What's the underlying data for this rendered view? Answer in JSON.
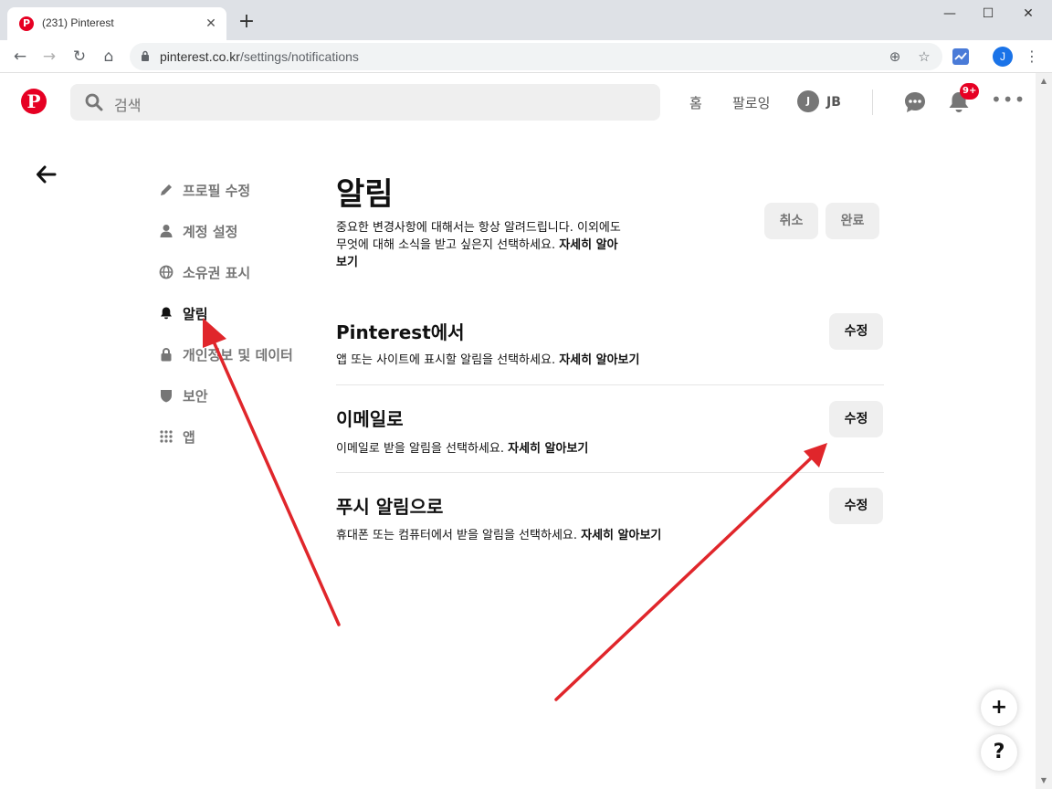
{
  "browser": {
    "tab_title": "(231) Pinterest",
    "tab_close": "✕",
    "new_tab": "+",
    "window_controls": {
      "minimize": "—",
      "maximize": "☐",
      "close": "✕"
    },
    "url_host": "pinterest.co.kr",
    "url_path": "/settings/notifications",
    "profile_initial": "J"
  },
  "header": {
    "logo_letter": "P",
    "search_placeholder": "검색",
    "nav": {
      "home": "홈",
      "following": "팔로잉"
    },
    "user": {
      "initial": "J",
      "name": "JB"
    },
    "notification_badge": "9+",
    "more": "•••"
  },
  "sidebar": {
    "items": [
      {
        "label": "프로필 수정",
        "icon": "pencil-icon"
      },
      {
        "label": "계정 설정",
        "icon": "person-icon"
      },
      {
        "label": "소유권 표시",
        "icon": "globe-icon"
      },
      {
        "label": "알림",
        "icon": "bell-icon",
        "active": true
      },
      {
        "label": "개인정보 및 데이터",
        "icon": "lock-icon"
      },
      {
        "label": "보안",
        "icon": "shield-icon"
      },
      {
        "label": "앱",
        "icon": "grid-icon"
      }
    ]
  },
  "main": {
    "title": "알림",
    "desc_line1": "중요한 변경사항에 대해서는 항상 알려드립니다. 이외에도",
    "desc_line2": "무엇에 대해 소식을 받고 싶은지 선택하세요.",
    "desc_link_part1": "자세히 알아",
    "desc_link_part2": "보기",
    "cancel_label": "취소",
    "done_label": "완료",
    "sections": [
      {
        "title": "Pinterest에서",
        "desc": "앱 또는 사이트에 표시할 알림을 선택하세요.",
        "link": "자세히 알아보기",
        "button": "수정"
      },
      {
        "title": "이메일로",
        "desc": "이메일로 받을 알림을 선택하세요.",
        "link": "자세히 알아보기",
        "button": "수정"
      },
      {
        "title": "푸시 알림으로",
        "desc": "휴대폰 또는 컴퓨터에서 받을 알림을 선택하세요.",
        "link": "자세히 알아보기",
        "button": "수정"
      }
    ]
  },
  "fab": {
    "add": "+",
    "help": "?"
  },
  "colors": {
    "brand": "#e60023",
    "annotation_arrow": "#e0262b"
  }
}
